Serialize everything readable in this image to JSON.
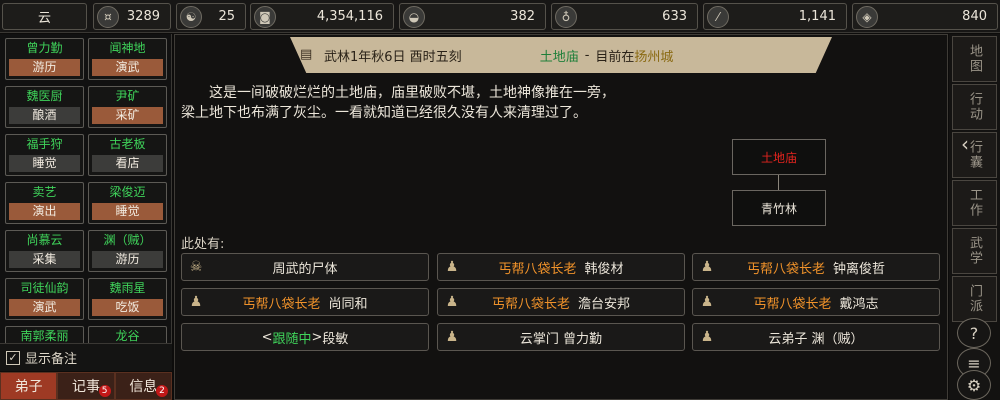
{
  "topbar": {
    "sect": "云",
    "resources": [
      {
        "icon": "coin-icon",
        "glyph": "¤",
        "value": "3289"
      },
      {
        "icon": "yin-yang-icon",
        "glyph": "☯",
        "value": "25"
      },
      {
        "icon": "copper-coin-icon",
        "glyph": "◙",
        "value": "4,354,116"
      },
      {
        "icon": "food-bowl-icon",
        "glyph": "◒",
        "value": "382"
      },
      {
        "icon": "gourd-icon",
        "glyph": "♁",
        "value": "633"
      },
      {
        "icon": "wood-icon",
        "glyph": "⁄",
        "value": "1,141"
      },
      {
        "icon": "ore-icon",
        "glyph": "◈",
        "value": "840"
      }
    ]
  },
  "disciples": [
    {
      "name": "曾力勤",
      "action": "游历"
    },
    {
      "name": "闻神地",
      "action": "演武"
    },
    {
      "name": "魏医厨",
      "action": "酿酒"
    },
    {
      "name": "尹矿",
      "action": "采矿"
    },
    {
      "name": "福手狩",
      "action": "睡觉"
    },
    {
      "name": "古老板",
      "action": "看店"
    },
    {
      "name": "卖艺",
      "action": "演出"
    },
    {
      "name": "梁俊迈",
      "action": "睡觉"
    },
    {
      "name": "尚慕云",
      "action": "采集"
    },
    {
      "name": "渊（贼）",
      "action": "游历"
    },
    {
      "name": "司徒仙韵",
      "action": "演武"
    },
    {
      "name": "魏雨星",
      "action": "吃饭"
    },
    {
      "name": "南郭柔丽",
      "action": ""
    },
    {
      "name": "龙谷",
      "action": ""
    }
  ],
  "notes_label": "显示备注",
  "bottom_tabs": [
    {
      "label": "弟子",
      "count": ""
    },
    {
      "label": "记事",
      "count": "5"
    },
    {
      "label": "信息",
      "count": "2"
    }
  ],
  "header": {
    "time": "武林1年秋6日 酉时五刻",
    "location": "土地庙",
    "dash": "-",
    "here_prefix": "目前在",
    "city": "扬州城"
  },
  "description": "这是一间破破烂烂的土地庙，庙里破败不堪，土地神像推在一旁，梁上地下也布满了灰尘。一看就知道已经很久没有人来清理过了。",
  "map": {
    "current": "土地庙",
    "exit": "青竹林"
  },
  "here_label": "此处有:",
  "npcs": [
    {
      "icon": "skull-icon",
      "title": "",
      "name": "周武的尸体"
    },
    {
      "icon": "person-icon",
      "title": "丐帮八袋长老",
      "name": "韩俊材"
    },
    {
      "icon": "person-icon",
      "title": "丐帮八袋长老",
      "name": "钟离俊哲"
    },
    {
      "icon": "person-icon",
      "title": "丐帮八袋长老",
      "name": "尚同和"
    },
    {
      "icon": "person-icon",
      "title": "丐帮八袋长老",
      "name": "澹台安邦"
    },
    {
      "icon": "person-icon",
      "title": "丐帮八袋长老",
      "name": "戴鸿志"
    },
    {
      "icon": "",
      "follow": "跟随中",
      "name": "段敏"
    },
    {
      "icon": "person-icon",
      "title": "",
      "name": "云掌门 曾力勤"
    },
    {
      "icon": "person-icon",
      "title": "",
      "name": "云弟子 渊（贼）"
    }
  ],
  "right_nav": [
    {
      "label": "地图",
      "icon": "map-icon"
    },
    {
      "label": "行动",
      "icon": "action-icon"
    },
    {
      "label": "行囊",
      "icon": "bag-icon"
    },
    {
      "label": "工作",
      "icon": "work-icon"
    },
    {
      "label": "武学",
      "icon": "martial-icon"
    },
    {
      "label": "门派",
      "icon": "sect-icon"
    }
  ],
  "colors": {
    "disciple_name": "#3fd35a",
    "action_bg": "#9a5a3a",
    "npc_title": "#f0922a",
    "current_loc": "#e2241e",
    "ribbon": "#c8b89a"
  }
}
